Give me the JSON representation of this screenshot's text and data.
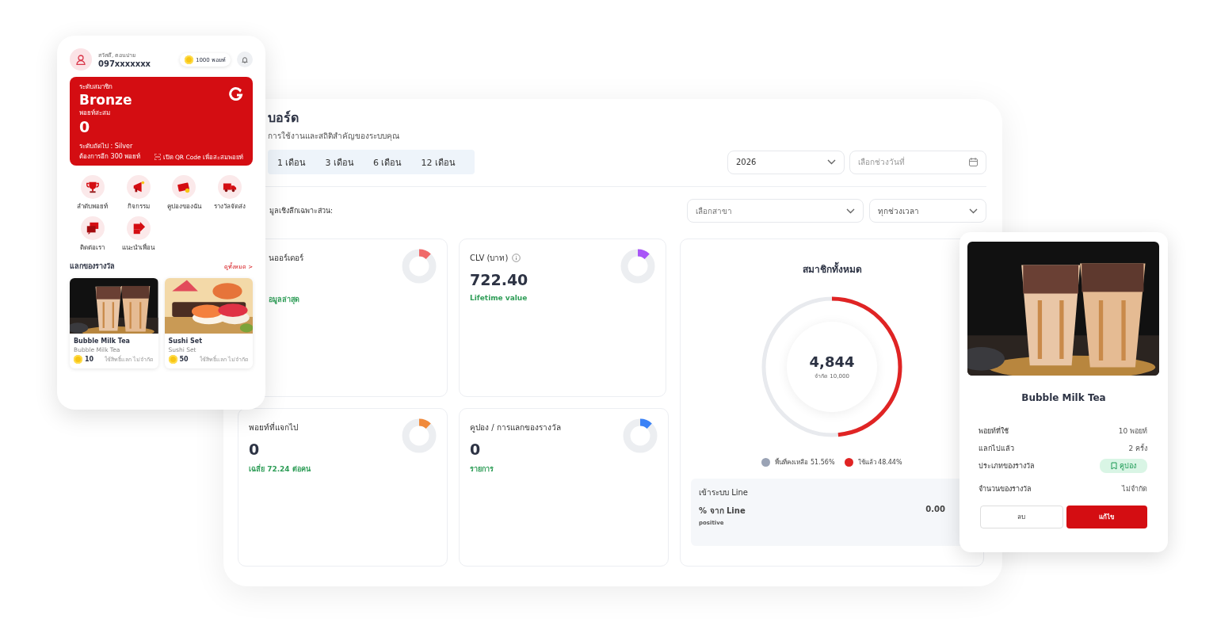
{
  "phone": {
    "greeting": "สวัสดี, ตอนบ่าย",
    "phone_number": "097xxxxxxx",
    "points_badge": "1000 พอยท์",
    "member_card": {
      "tier_label": "ระดับสมาชิก",
      "tier": "Bronze",
      "points_label": "พอยท์สะสม",
      "points": "0",
      "next_tier": "ระดับถัดไป : Silver",
      "needed": "ต้องการอีก 300 พอยท์",
      "qr_link": "เปิด QR Code เพื่อสะสมพอยท์"
    },
    "menu": [
      {
        "kind": "trophy",
        "label": "ลำดับพอยท์"
      },
      {
        "kind": "megaphone",
        "label": "กิจกรรม"
      },
      {
        "kind": "coupon",
        "label": "คูปองของฉัน"
      },
      {
        "kind": "truck",
        "label": "รางวัลจัดส่ง"
      },
      {
        "kind": "chat",
        "label": "ติดต่อเรา"
      },
      {
        "kind": "share",
        "label": "แนะนำเพื่อน"
      }
    ],
    "rewards_title": "แลกของรางวัล",
    "see_all": "ดูทั้งหมด >",
    "rewards": [
      {
        "kind": "picture",
        "name": "Bubble Milk Tea",
        "subtitle": "Bubble Milk Tea",
        "points": "10",
        "limit": "ใช้สิทธิ์แลก ไม่จำกัด"
      },
      {
        "kind": "picture",
        "name": "Sushi Set",
        "subtitle": "Sushi Set",
        "points": "50",
        "limit": "ใช้สิทธิ์แลก ไม่จำกัด"
      }
    ]
  },
  "dashboard": {
    "title": "บอร์ด",
    "subtitle": "การใช้งานและสถิติสำคัญของระบบคุณ",
    "periods": [
      {
        "label": "1 เดือน",
        "selected": false
      },
      {
        "label": "3 เดือน",
        "selected": false
      },
      {
        "label": "6 เดือน",
        "selected": false
      },
      {
        "label": "12 เดือน",
        "selected": false
      }
    ],
    "year_select": "2026",
    "date_range": {
      "placeholder": "เลือกช่วงวันที่"
    },
    "section_label": "มูลเชิงลึกเฉพาะส่วน:",
    "branch_select": {
      "placeholder": "เลือกสาขา"
    },
    "time_select": "ทุกช่วงเวลา",
    "stats": [
      {
        "title": "นออร์เดอร์",
        "note": "อมูลล่าสุด",
        "color": "#f06a6a",
        "level": 0.12
      },
      {
        "title": "CLV (บาท)",
        "info": true,
        "value": "722.40",
        "note": "Lifetime value",
        "color": "#a855f7",
        "level": 0.12
      },
      {
        "title": "พอยท์ที่แจกไป",
        "value": "0",
        "note": "เฉลี่ย 72.24 ต่อคน",
        "color": "#f08a3c",
        "level": 0.12
      },
      {
        "title": "คูปอง / การแลกของรางวัล",
        "value": "0",
        "note": "รายการ",
        "color": "#3b82f6",
        "level": 0.12
      }
    ],
    "members": {
      "title": "สมาชิกทั้งหมด",
      "value": "4,844",
      "limit": "จำกัด 10,000",
      "level": 0.4844,
      "legend": [
        {
          "label": "พื้นที่คงเหลือ 51.56%",
          "color": "#9aa3b5"
        },
        {
          "label": "ใช้แล้ว 48.44%",
          "color": "#e02424"
        }
      ],
      "line": {
        "title": "เข้าระบบ Line",
        "label": "% จาก Line",
        "value": "0.00",
        "note": "positive"
      }
    }
  },
  "reward_detail": {
    "name": "Bubble Milk Tea",
    "rows": [
      {
        "kind": "text",
        "label": "พอยท์ที่ใช้",
        "value": "10 พอยท์"
      },
      {
        "kind": "text",
        "label": "แลกไปแล้ว",
        "value": "2 ครั้ง"
      },
      {
        "kind": "tag",
        "label": "ประเภทของรางวัล",
        "value": "คูปอง"
      },
      {
        "kind": "text",
        "label": "จำนวนของรางวัล",
        "value": "ไม่จำกัด"
      }
    ],
    "delete_button": "ลบ",
    "edit_button": "แก้ไข"
  }
}
